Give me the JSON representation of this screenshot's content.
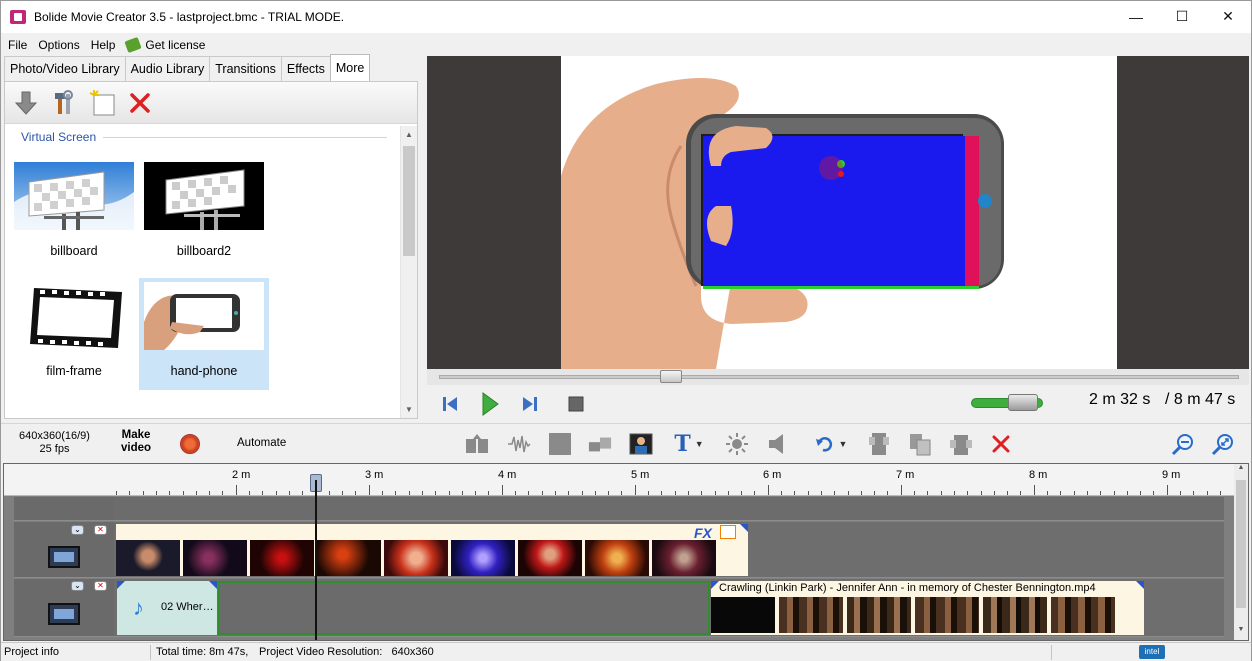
{
  "window": {
    "title": "Bolide Movie Creator 3.5 - lastproject.bmc  - TRIAL MODE.",
    "controls": {
      "minimize": "—",
      "maximize": "☐",
      "close": "✕"
    }
  },
  "menu": {
    "items": [
      "File",
      "Options",
      "Help"
    ],
    "license": "Get license"
  },
  "library": {
    "tabs": [
      "Photo/Video Library",
      "Audio Library",
      "Transitions",
      "Effects",
      "More"
    ],
    "active_tab": "More",
    "toolbar_icons": [
      "import-arrow-icon",
      "tools-icon",
      "new-item-icon",
      "delete-x-icon"
    ],
    "section": "Virtual Screen",
    "items": [
      {
        "label": "billboard"
      },
      {
        "label": "billboard2"
      },
      {
        "label": "film-frame"
      },
      {
        "label": "hand-phone",
        "selected": true
      }
    ]
  },
  "player": {
    "current_time": "2 m 32 s",
    "total_time": "/ 8 m 47 s",
    "seek_position": 0.29,
    "volume": 0.72
  },
  "project": {
    "resolution": "640x360(16/9)",
    "fps": "25 fps",
    "make_video_line1": "Make",
    "make_video_line2": "video",
    "automate": "Automate"
  },
  "toolbar": {
    "icons": [
      "split-icon",
      "audio-wave-icon",
      "crop-icon",
      "resize-icon",
      "image-icon",
      "text-icon",
      "brightness-icon",
      "volume-icon",
      "undo-icon",
      "copy-icon",
      "paste-icon",
      "paste-special-icon",
      "delete-icon",
      "zoom-out-icon",
      "zoom-fit-icon"
    ],
    "text_glyph": "T"
  },
  "timeline": {
    "ruler_labels": [
      "2 m",
      "3 m",
      "4 m",
      "5 m",
      "6 m",
      "7 m",
      "8 m",
      "9 m"
    ],
    "tracks": [
      {
        "type": "video",
        "fx_label": "FX"
      },
      {
        "type": "audio-video",
        "audio_clip_label": "02 Wher…",
        "video_clip_label": "Crawling (Linkin Park) - Jennifer Ann - in memory of Chester Bennington.mp4"
      }
    ]
  },
  "status": {
    "project_info": "Project info",
    "total_time": "Total time: 8m 47s,",
    "resolution": "Project Video Resolution:   640x360",
    "intel": "intel"
  },
  "colors": {
    "accent_blue": "#2a56a8",
    "selection": "#cce4f7",
    "play_green": "#3fae3f",
    "delete_red": "#e02020",
    "clip_bg": "#fdf6e3",
    "audio_clip": "#cfe7e3"
  }
}
